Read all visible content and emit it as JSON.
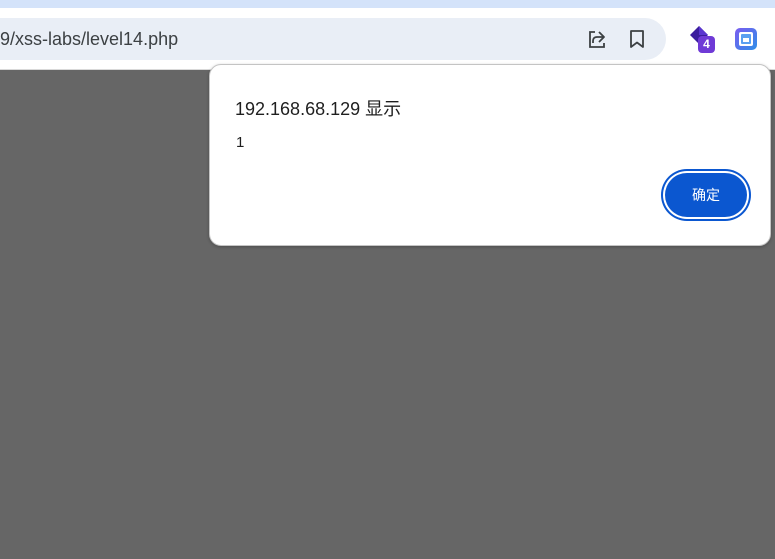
{
  "browser": {
    "url": "9/xss-labs/level14.php",
    "extension_badge": "4",
    "icons": [
      "share-icon",
      "bookmark-icon",
      "extension-diamond-icon",
      "extension-square-icon"
    ]
  },
  "dialog": {
    "title": "192.168.68.129 显示",
    "message": "1",
    "ok_label": "确定"
  },
  "colors": {
    "page_background": "#666666",
    "toolbar": "#ffffff",
    "omnibox": "#e9eef6",
    "primary_button": "#0b57d0",
    "extension_badge": "#6f3ad6"
  }
}
